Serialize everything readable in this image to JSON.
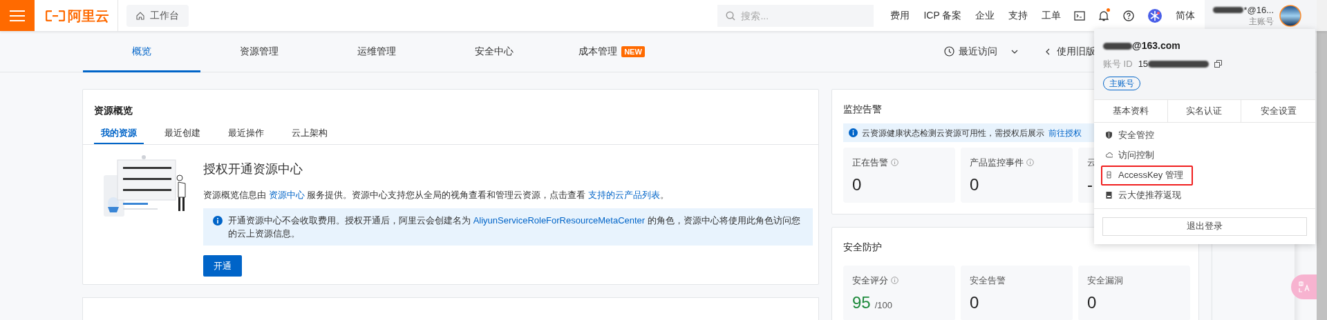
{
  "top_bar": {
    "logo": "阿里云",
    "workbench": "工作台",
    "search": {
      "placeholder": "搜索..."
    },
    "links": [
      "费用",
      "ICP 备案",
      "企业",
      "支持",
      "工单"
    ],
    "notifications": {
      "unread": true
    },
    "language": "简体",
    "account": {
      "name": "*@16...",
      "role": "主账号"
    }
  },
  "nav_tabs": [
    {
      "label": "概览",
      "selected": true
    },
    {
      "label": "资源管理",
      "selected": false
    },
    {
      "label": "运维管理",
      "selected": false
    },
    {
      "label": "安全中心",
      "selected": false
    },
    {
      "label": "成本管理",
      "selected": false,
      "badge": "NEW"
    }
  ],
  "recent_visits": "最近访问",
  "old_version": "使用旧版",
  "resource_card": {
    "title": "资源概览",
    "tabs": [
      {
        "label": "我的资源",
        "selected": true
      },
      {
        "label": "最近创建",
        "selected": false
      },
      {
        "label": "最近操作",
        "selected": false
      },
      {
        "label": "云上架构",
        "selected": false
      }
    ],
    "heading": "授权开通资源中心",
    "description_parts": [
      "资源概览信息由 ",
      "资源中心",
      " 服务提供。资源中心支持您从全局的视角查看和管理云资源，点击查看 ",
      "支持的云产品列表",
      "。"
    ],
    "notice_parts": [
      "开通资源中心不会收取费用。授权开通后，阿里云会创建名为 ",
      "AliyunServiceRoleForResourceMetaCenter",
      " 的角色，资源中心将使用此角色访问您的云上资源信息。"
    ],
    "button": "开通"
  },
  "monitor_card": {
    "title": "监控告警",
    "notice": "云资源健康状态检测云资源可用性，需授权后展示",
    "notice_link": "前往授权",
    "metrics": [
      {
        "label": "正在告警",
        "info": true,
        "value": "0",
        "kind": "plain"
      },
      {
        "label": "产品监控事件",
        "info": true,
        "value": "0",
        "kind": "plain"
      },
      {
        "label": "云",
        "info": false,
        "value": "-",
        "kind": "plain"
      }
    ]
  },
  "security_card": {
    "title": "安全防护",
    "metrics": [
      {
        "label": "安全评分",
        "info": true,
        "value": "95",
        "suffix": "/100",
        "kind": "score"
      },
      {
        "label": "安全告警",
        "info": false,
        "value": "0",
        "kind": "plain"
      },
      {
        "label": "安全漏洞",
        "info": false,
        "value": "0",
        "kind": "plain"
      }
    ]
  },
  "account_menu": {
    "email": "@163.com",
    "id_label": "账号 ID",
    "id": "15",
    "role": "主账号",
    "tabs": [
      "基本资料",
      "实名认证",
      "安全设置"
    ],
    "items": [
      {
        "label": "安全管控",
        "highlighted": false
      },
      {
        "label": "访问控制",
        "highlighted": false
      },
      {
        "label": "AccessKey 管理",
        "highlighted": true
      },
      {
        "label": "云大使推荐返现",
        "highlighted": false
      }
    ],
    "logout": "退出登录"
  }
}
